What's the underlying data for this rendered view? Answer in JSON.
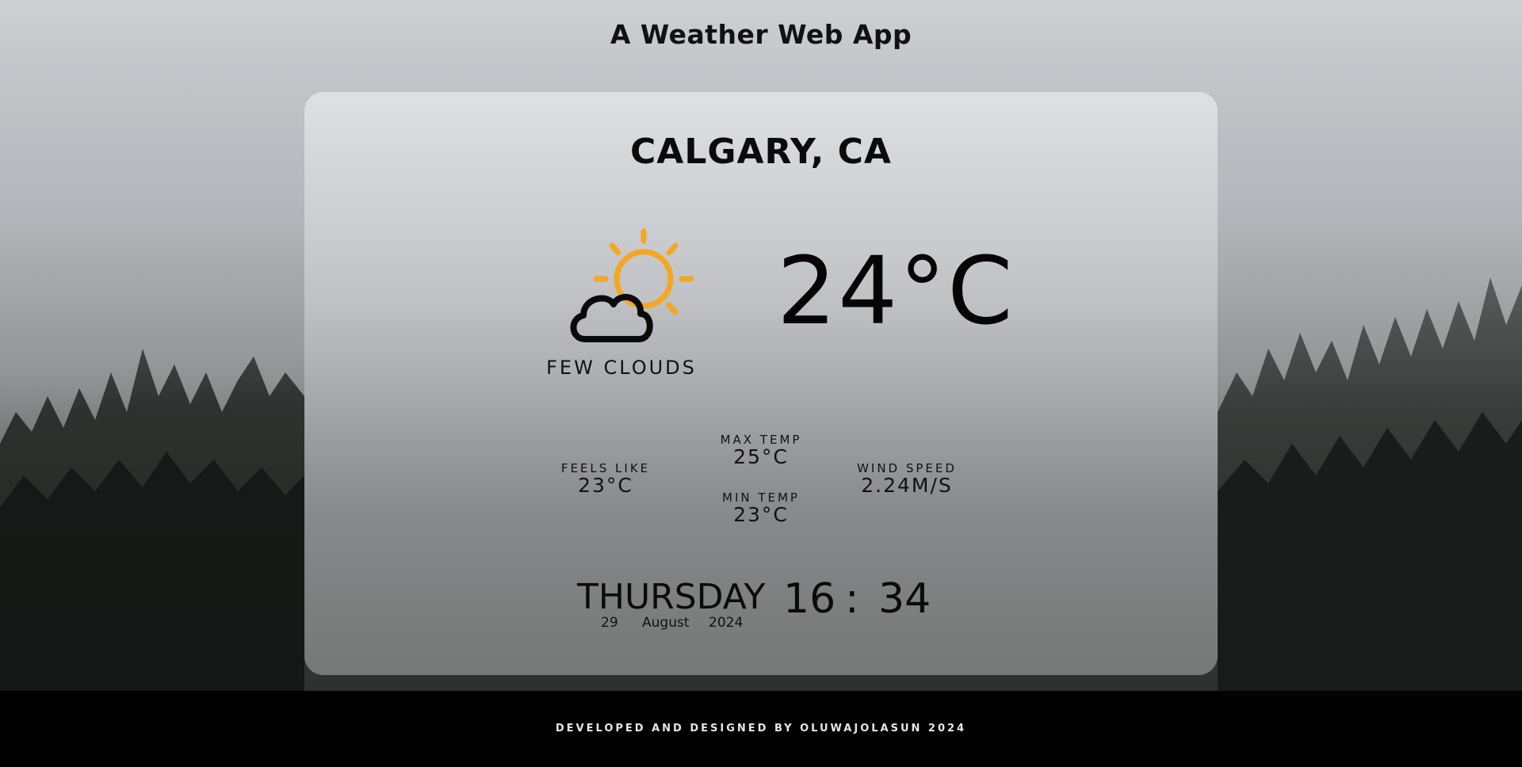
{
  "app": {
    "title": "A Weather Web App"
  },
  "weather": {
    "city": "CALGARY, CA",
    "condition": "FEW CLOUDS",
    "icon": "few-clouds-day-icon",
    "temperature": "24°C",
    "feels_like": {
      "label": "FEELS LIKE",
      "value": "23°C"
    },
    "max_temp": {
      "label": "MAX TEMP",
      "value": "25°C"
    },
    "min_temp": {
      "label": "MIN TEMP",
      "value": "23°C"
    },
    "wind_speed": {
      "label": "WIND SPEED",
      "value": "2.24M/S"
    }
  },
  "datetime": {
    "weekday": "THURSDAY",
    "day": "29",
    "month": "August",
    "year": "2024",
    "hours": "16",
    "separator": ":",
    "minutes": "34"
  },
  "footer": {
    "credit": "DEVELOPED AND DESIGNED BY OLUWAJOLASUN 2024"
  },
  "colors": {
    "sun": "#f5a623",
    "text": "#0b0b0b",
    "footer_bg": "#000000"
  }
}
